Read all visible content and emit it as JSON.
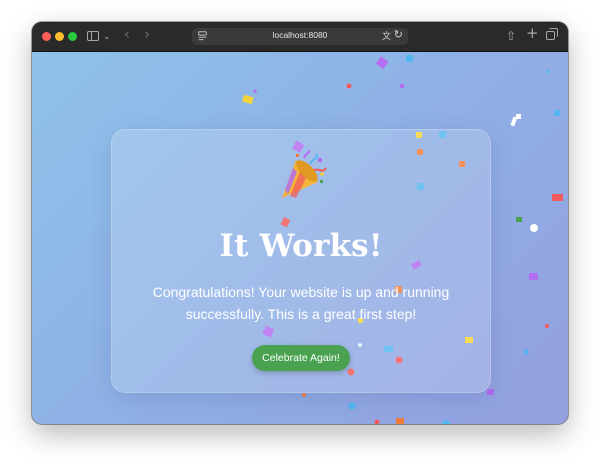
{
  "browser": {
    "url": "localhost:8080",
    "icons": [
      "sidebar-icon",
      "chevron-down-icon",
      "back-icon",
      "forward-icon",
      "page-icon",
      "translate-icon",
      "reload-icon",
      "share-icon",
      "new-tab-icon",
      "tabs-overview-icon"
    ]
  },
  "page": {
    "title": "It Works!",
    "message": "Congratulations! Your website is up and running successfully. This is a great first step!",
    "button_label": "Celebrate Again!",
    "emoji": "party-popper",
    "colors": {
      "button": "#4aa250",
      "background_start": "#8ec2e9",
      "background_end": "#949fe0",
      "text": "#ffffff"
    }
  }
}
